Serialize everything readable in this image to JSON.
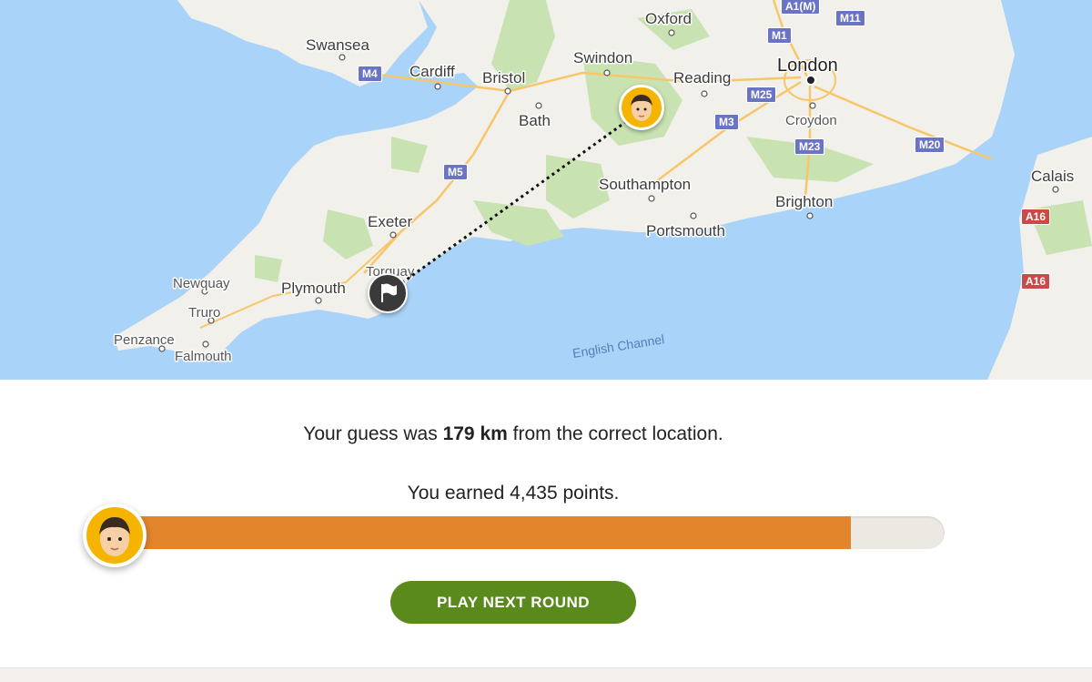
{
  "map": {
    "cities": [
      "Oxford",
      "Swansea",
      "Swindon",
      "Cardiff",
      "Bristol",
      "Reading",
      "London",
      "Bath",
      "Croydon",
      "Calais",
      "Southampton",
      "Brighton",
      "Exeter",
      "Portsmouth",
      "Newquay",
      "Plymouth",
      "Torquay",
      "Truro",
      "Penzance",
      "Falmouth"
    ],
    "sea_label": "English Channel",
    "roads": [
      "A1(M)",
      "M11",
      "M1",
      "M4",
      "M25",
      "M3",
      "M23",
      "M20",
      "M5",
      "A16",
      "A16"
    ]
  },
  "result": {
    "distance_prefix": "Your guess was ",
    "distance_value": "179 km",
    "distance_suffix": " from the correct location.",
    "points_text": "You earned 4,435 points.",
    "points_fraction": 0.887,
    "next_button_label": "PLAY NEXT ROUND"
  },
  "colors": {
    "progress_fill": "#e3852b",
    "button": "#5b8a1c",
    "avatar_bg": "#f5b400"
  },
  "icons": {
    "guess_marker": "person-avatar-icon",
    "answer_marker": "flag-icon"
  }
}
